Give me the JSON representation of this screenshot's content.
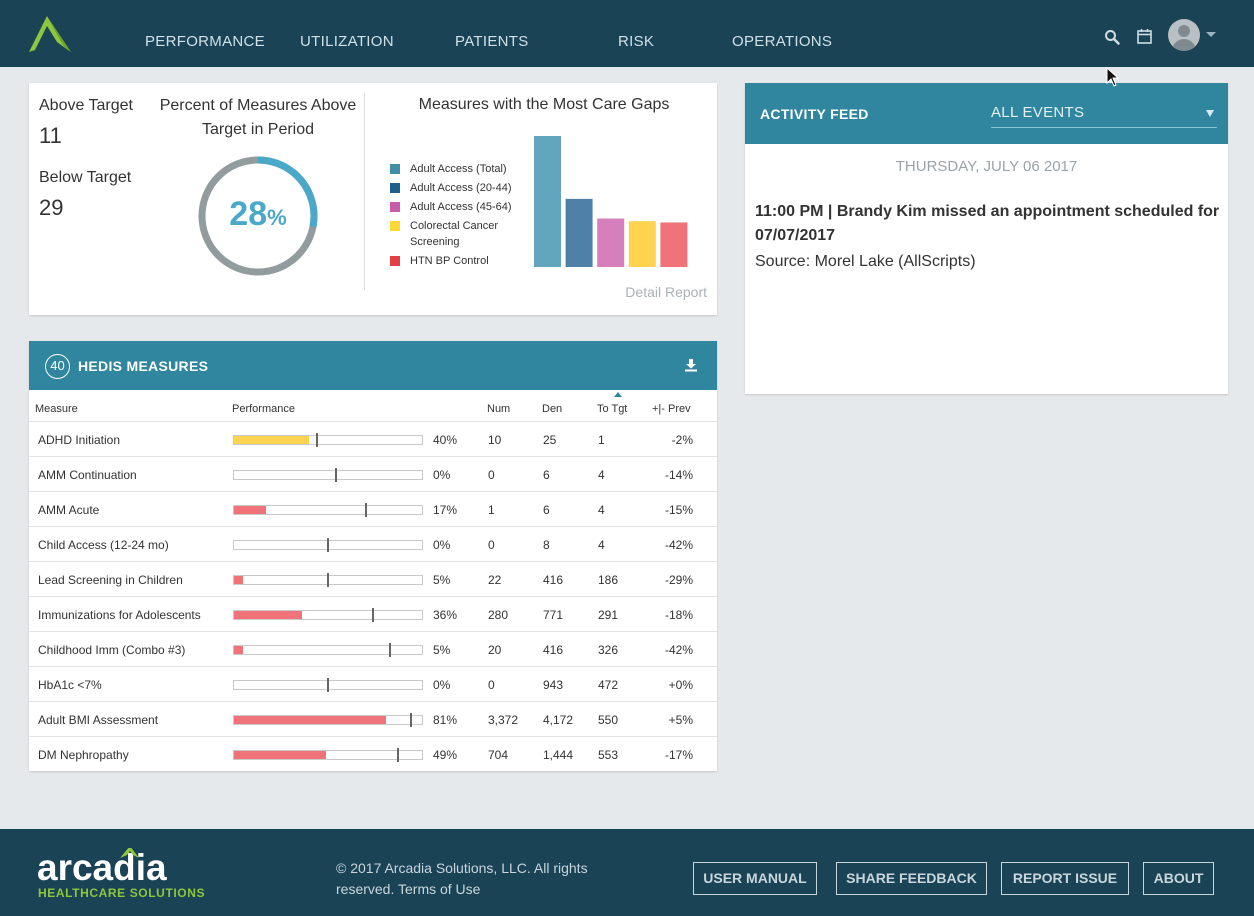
{
  "nav": {
    "items": [
      {
        "label": "PERFORMANCE"
      },
      {
        "label": "UTILIZATION"
      },
      {
        "label": "PATIENTS"
      },
      {
        "label": "RISK"
      },
      {
        "label": "OPERATIONS"
      }
    ],
    "icons": [
      "search-icon",
      "calendar-icon",
      "avatar",
      "chevron-down-icon"
    ]
  },
  "summary": {
    "above_label": "Above Target",
    "above_value": "11",
    "below_label": "Below Target",
    "below_value": "29",
    "percent_title": "Percent of Measures Above Target in Period",
    "percent_value": "28",
    "percent_sign": "%",
    "percent_fraction": 0.28,
    "gaps_title": "Measures with the Most Care Gaps",
    "detail_link": "Detail Report"
  },
  "chart_data": {
    "type": "bar",
    "title": "Measures with the Most Care Gaps",
    "categories": [
      "Adult Access (Total)",
      "Adult Access (20-44)",
      "Adult Access (45-64)",
      "Colorectal Cancer Screening",
      "HTN BP Control"
    ],
    "values": [
      100,
      52,
      37,
      35,
      34
    ],
    "colors": [
      "#62a6bd",
      "#4f81a8",
      "#d77fbd",
      "#fdd34f",
      "#ef7378"
    ],
    "legend_colors": [
      "#3f8fa6",
      "#1f5f8b",
      "#c85bab",
      "#fdd835",
      "#e53f46"
    ],
    "legend_position": "left",
    "grid": false
  },
  "hedis": {
    "count": "40",
    "title": "HEDIS MEASURES",
    "columns": {
      "measure": "Measure",
      "performance": "Performance",
      "num": "Num",
      "den": "Den",
      "to_tgt": "To Tgt",
      "prev": "+|- Prev"
    },
    "rows": [
      {
        "measure": "ADHD Initiation",
        "pct": "40%",
        "value": 0.4,
        "target": 0.44,
        "color": "#fdd34f",
        "num": "10",
        "den": "25",
        "to_tgt": "1",
        "prev": "-2%"
      },
      {
        "measure": "AMM Continuation",
        "pct": "0%",
        "value": 0.0,
        "target": 0.54,
        "color": "#ef7378",
        "num": "0",
        "den": "6",
        "to_tgt": "4",
        "prev": "-14%"
      },
      {
        "measure": "AMM Acute",
        "pct": "17%",
        "value": 0.17,
        "target": 0.7,
        "color": "#ef7378",
        "num": "1",
        "den": "6",
        "to_tgt": "4",
        "prev": "-15%"
      },
      {
        "measure": "Child Access (12-24 mo)",
        "pct": "0%",
        "value": 0.0,
        "target": 0.5,
        "color": "#ef7378",
        "num": "0",
        "den": "8",
        "to_tgt": "4",
        "prev": "-42%"
      },
      {
        "measure": "Lead Screening in Children",
        "pct": "5%",
        "value": 0.05,
        "target": 0.5,
        "color": "#ef7378",
        "num": "22",
        "den": "416",
        "to_tgt": "186",
        "prev": "-29%"
      },
      {
        "measure": "Immunizations for Adolescents",
        "pct": "36%",
        "value": 0.36,
        "target": 0.74,
        "color": "#ef7378",
        "num": "280",
        "den": "771",
        "to_tgt": "291",
        "prev": "-18%"
      },
      {
        "measure": "Childhood Imm (Combo #3)",
        "pct": "5%",
        "value": 0.05,
        "target": 0.83,
        "color": "#ef7378",
        "num": "20",
        "den": "416",
        "to_tgt": "326",
        "prev": "-42%"
      },
      {
        "measure": "HbA1c <7%",
        "pct": "0%",
        "value": 0.0,
        "target": 0.5,
        "color": "#ef7378",
        "num": "0",
        "den": "943",
        "to_tgt": "472",
        "prev": "+0%"
      },
      {
        "measure": "Adult BMI Assessment",
        "pct": "81%",
        "value": 0.81,
        "target": 0.94,
        "color": "#ef7378",
        "num": "3,372",
        "den": "4,172",
        "to_tgt": "550",
        "prev": "+5%"
      },
      {
        "measure": "DM Nephropathy",
        "pct": "49%",
        "value": 0.49,
        "target": 0.87,
        "color": "#ef7378",
        "num": "704",
        "den": "1,444",
        "to_tgt": "553",
        "prev": "-17%"
      }
    ]
  },
  "feed": {
    "title": "ACTIVITY FEED",
    "filter_value": "ALL EVENTS",
    "date": "THURSDAY, JULY 06 2017",
    "event": "11:00 PM | Brandy Kim missed an appointment scheduled for 07/07/2017",
    "source": "Source: Morel Lake (AllScripts)"
  },
  "footer": {
    "brand": "arcadia",
    "brand_sub": "HEALTHCARE SOLUTIONS",
    "copyright": "© 2017 Arcadia Solutions, LLC. All rights reserved. Terms of Use",
    "buttons": [
      {
        "label": "USER MANUAL"
      },
      {
        "label": "SHARE FEEDBACK"
      },
      {
        "label": "REPORT ISSUE"
      },
      {
        "label": "ABOUT"
      }
    ]
  },
  "colors": {
    "topbar": "#1b4356",
    "accent": "#2f869e",
    "donut": "#4aa8c8",
    "donut_track": "#929c9f",
    "brand_green": "#8dc63f"
  }
}
